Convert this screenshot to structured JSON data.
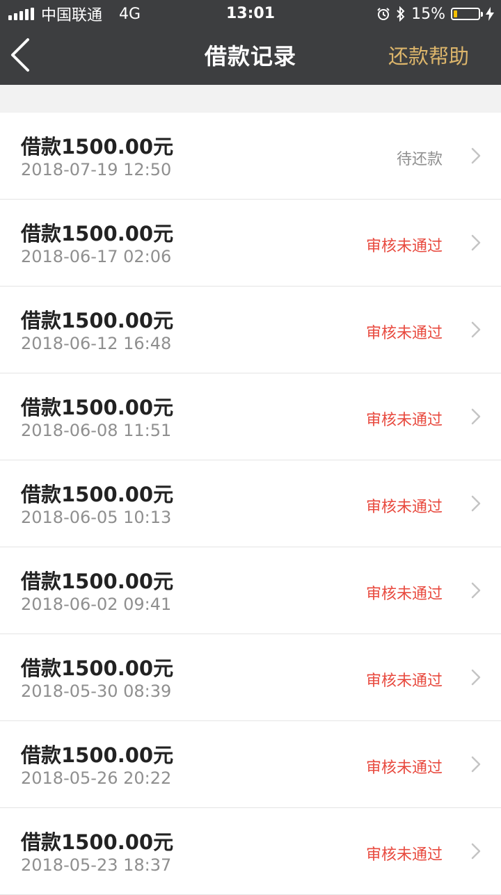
{
  "status_bar": {
    "carrier": "中国联通",
    "network": "4G",
    "time": "13:01",
    "battery_percent": "15%",
    "battery_level": 0.15,
    "battery_color": "#f5c000"
  },
  "nav": {
    "back_icon": "chevron-left-icon",
    "title": "借款记录",
    "help_label": "还款帮助",
    "help_color": "#dcb56b"
  },
  "colors": {
    "header_bg": "#3d3e40",
    "status_pending": "#8f8f8f",
    "status_rejected": "#e84a3f"
  },
  "records": [
    {
      "amount": "借款1500.00元",
      "date": "2018-07-19 12:50",
      "status": "待还款",
      "status_type": "pending"
    },
    {
      "amount": "借款1500.00元",
      "date": "2018-06-17 02:06",
      "status": "审核未通过",
      "status_type": "rejected"
    },
    {
      "amount": "借款1500.00元",
      "date": "2018-06-12 16:48",
      "status": "审核未通过",
      "status_type": "rejected"
    },
    {
      "amount": "借款1500.00元",
      "date": "2018-06-08 11:51",
      "status": "审核未通过",
      "status_type": "rejected"
    },
    {
      "amount": "借款1500.00元",
      "date": "2018-06-05 10:13",
      "status": "审核未通过",
      "status_type": "rejected"
    },
    {
      "amount": "借款1500.00元",
      "date": "2018-06-02 09:41",
      "status": "审核未通过",
      "status_type": "rejected"
    },
    {
      "amount": "借款1500.00元",
      "date": "2018-05-30 08:39",
      "status": "审核未通过",
      "status_type": "rejected"
    },
    {
      "amount": "借款1500.00元",
      "date": "2018-05-26 20:22",
      "status": "审核未通过",
      "status_type": "rejected"
    },
    {
      "amount": "借款1500.00元",
      "date": "2018-05-23 18:37",
      "status": "审核未通过",
      "status_type": "rejected"
    }
  ]
}
